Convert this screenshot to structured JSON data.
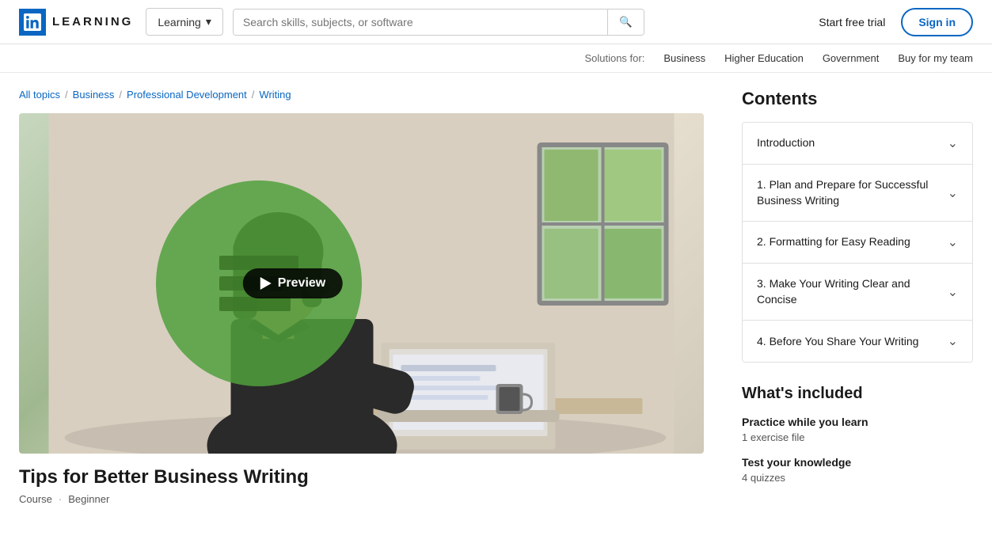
{
  "header": {
    "logo_text": "LEARNING",
    "dropdown_label": "Learning",
    "search_placeholder": "Search skills, subjects, or software",
    "start_trial": "Start free trial",
    "sign_in": "Sign in"
  },
  "solutions_bar": {
    "label": "Solutions for:",
    "links": [
      "Business",
      "Higher Education",
      "Government",
      "Buy for my team"
    ]
  },
  "breadcrumb": {
    "items": [
      "All topics",
      "Business",
      "Professional Development",
      "Writing"
    ]
  },
  "course": {
    "title": "Tips for Better Business Writing",
    "type": "Course",
    "level": "Beginner",
    "play_label": "Preview"
  },
  "contents": {
    "heading": "Contents",
    "items": [
      {
        "label": "Introduction"
      },
      {
        "label": "1. Plan and Prepare for Successful Business Writing"
      },
      {
        "label": "2. Formatting for Easy Reading"
      },
      {
        "label": "3. Make Your Writing Clear and Concise"
      },
      {
        "label": "4. Before You Share Your Writing"
      }
    ]
  },
  "whats_included": {
    "heading": "What's included",
    "items": [
      {
        "title": "Practice while you learn",
        "sub": "1 exercise file"
      },
      {
        "title": "Test your knowledge",
        "sub": "4 quizzes"
      }
    ]
  }
}
